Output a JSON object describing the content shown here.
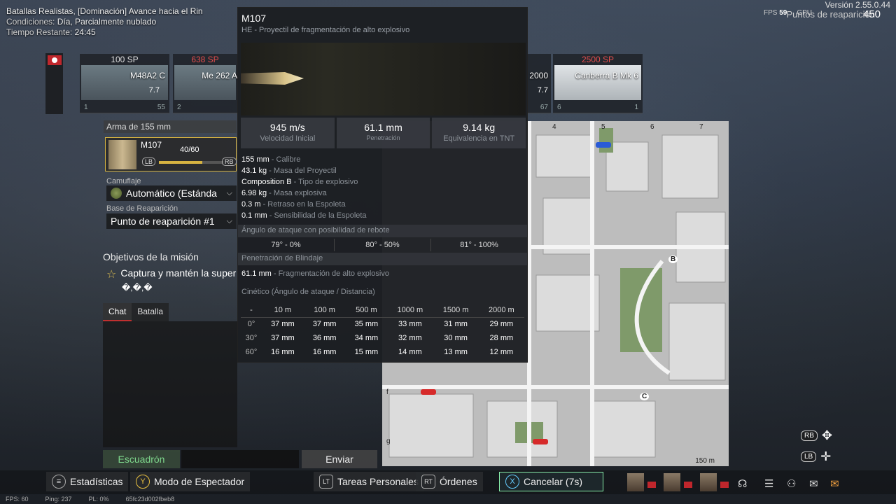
{
  "battle": {
    "title": "Batallas Realistas, [Dominación] Avance hacia el Rin",
    "conditions_label": "Condiciones:",
    "conditions_value": "Día, Parcialmente nublado",
    "time_label": "Tiempo Restante:",
    "time_value": "24:45"
  },
  "top_right": {
    "version": "Versión 2.55.0.44",
    "fps_label": "FPS",
    "fps_value": "59",
    "gpu_label": "GPU",
    "respawn_label": "Puntos de reaparición",
    "respawn_points": "450"
  },
  "slots": [
    {
      "price": "100 SP",
      "name": "M48A2 C",
      "br": "7.7",
      "crew": "1",
      "rank": "55"
    },
    {
      "price": "638 SP",
      "name": "Me 262 A",
      "br": "",
      "crew": "2",
      "rank": ""
    },
    {
      "price": "",
      "name": "2000",
      "br": "7.7",
      "crew": "",
      "rank": "67"
    },
    {
      "price": "2500 SP",
      "name": "Canberra B Mk 6",
      "br": "",
      "crew": "6",
      "rank": "1"
    }
  ],
  "weapon": {
    "section_label": "Arma de 155 mm",
    "name": "M107",
    "ammo": "40/60",
    "ammo_fraction": 0.67,
    "lb": "LB",
    "rb": "RB"
  },
  "camo": {
    "label": "Camuflaje",
    "value": "Automático (Estánda"
  },
  "respawn_base": {
    "label": "Base de Reaparición",
    "value": "Punto de reaparición #1"
  },
  "mission": {
    "title": "Objetivos de la misión",
    "objective": "Captura y mantén la super",
    "marks": "�,�,�"
  },
  "chat": {
    "tabs": [
      "Chat",
      "Batalla"
    ],
    "squad_button": "Escuadrón",
    "send_button": "Enviar"
  },
  "map": {
    "col_numbers": [
      "4",
      "5",
      "6",
      "7"
    ],
    "row_letters": [
      "f",
      "g"
    ],
    "point_labels": [
      "B",
      "C"
    ],
    "scale": "150 m"
  },
  "tooltip": {
    "title": "M107",
    "subtitle": "HE - Proyectil de fragmentación de alto explosivo",
    "stats": [
      {
        "value": "945 m/s",
        "label": "Velocidad Inicial"
      },
      {
        "value": "61.1 mm",
        "label": "Penetración"
      },
      {
        "value": "9.14 kg",
        "label": "Equivalencia en TNT"
      }
    ],
    "props": [
      {
        "value": "155 mm",
        "desc": " - Calibre"
      },
      {
        "value": "43.1 kg",
        "desc": " - Masa del Proyectil"
      },
      {
        "value": "Composition B",
        "desc": " - Tipo de explosivo"
      },
      {
        "value": "6.98 kg",
        "desc": " - Masa explosiva"
      },
      {
        "value": "0.3 m",
        "desc": " - Retraso en la Espoleta"
      },
      {
        "value": "0.1 mm",
        "desc": " - Sensibilidad de la Espoleta"
      }
    ],
    "ricochet_title": "Ángulo de ataque con posibilidad de rebote",
    "ricochet": [
      "79° - 0%",
      "80° - 50%",
      "81° - 100%"
    ],
    "armor_title": "Penetración de Blindaje",
    "armor_value": "61.1 mm",
    "armor_desc": " - Fragmentación de alto explosivo",
    "kinetic_title": "Cinético (Ángulo de ataque / Distancia)",
    "table": {
      "headers": [
        "-",
        "10 m",
        "100 m",
        "500 m",
        "1000 m",
        "1500 m",
        "2000 m"
      ],
      "rows": [
        [
          "0°",
          "37 mm",
          "37 mm",
          "35 mm",
          "33 mm",
          "31 mm",
          "29 mm"
        ],
        [
          "30°",
          "37 mm",
          "36 mm",
          "34 mm",
          "32 mm",
          "30 mm",
          "28 mm"
        ],
        [
          "60°",
          "16 mm",
          "16 mm",
          "15 mm",
          "14 mm",
          "13 mm",
          "12 mm"
        ]
      ]
    }
  },
  "bottom": {
    "stats": "Estadísticas",
    "spectator": "Modo de Espectador",
    "tasks": "Tareas Personales",
    "orders": "Órdenes",
    "cancel": "Cancelar (7s)",
    "stats_key": "≡",
    "spectator_key": "Y",
    "tasks_key": "LT",
    "orders_key": "RT",
    "cancel_key": "X"
  },
  "status": {
    "fps": "FPS: 60",
    "ping": "Ping: 237",
    "pl": "PL: 0%",
    "session": "65fc23d002fbeb8"
  },
  "controls": {
    "rb": "RB",
    "lb": "LB"
  },
  "colors": {
    "accent_gold": "#d6b341",
    "enemy_red": "#e24c4c",
    "squad_green": "#7ed78c"
  }
}
